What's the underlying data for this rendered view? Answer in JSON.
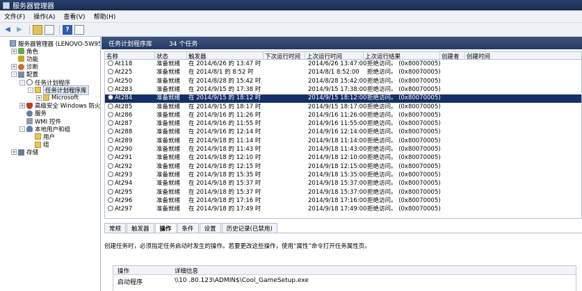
{
  "window": {
    "title": "服务器管理器"
  },
  "menu": [
    "文件(F)",
    "操作(A)",
    "查看(V)",
    "帮助(H)"
  ],
  "toolbar": {
    "icons": [
      "back-arrow-icon",
      "forward-arrow-icon",
      "up-folder-icon",
      "show-hide-tree-icon",
      "help-icon",
      "properties-icon"
    ]
  },
  "tree": [
    {
      "label": "服务器管理器 (LENOVO-5W9563FA",
      "indent": 0,
      "icon": "srv",
      "expander": ""
    },
    {
      "label": "角色",
      "indent": 1,
      "icon": "role",
      "expander": "+"
    },
    {
      "label": "功能",
      "indent": 1,
      "icon": "feat",
      "expander": ""
    },
    {
      "label": "诊断",
      "indent": 1,
      "icon": "diag",
      "expander": "+"
    },
    {
      "label": "配置",
      "indent": 1,
      "icon": "conf",
      "expander": "-"
    },
    {
      "label": "任务计划程序",
      "indent": 2,
      "icon": "clock",
      "expander": "-"
    },
    {
      "label": "任务计划程序库",
      "indent": 3,
      "icon": "fold",
      "expander": "-",
      "selected": true
    },
    {
      "label": "Microsoft",
      "indent": 4,
      "icon": "fold",
      "expander": "+"
    },
    {
      "label": "高级安全 Windows 防火墙",
      "indent": 2,
      "icon": "shield",
      "expander": "+"
    },
    {
      "label": "服务",
      "indent": 2,
      "icon": "svc",
      "expander": ""
    },
    {
      "label": "WMI 控件",
      "indent": 2,
      "icon": "wmi",
      "expander": ""
    },
    {
      "label": "本地用户和组",
      "indent": 2,
      "icon": "users",
      "expander": "-"
    },
    {
      "label": "用户",
      "indent": 3,
      "icon": "fold",
      "expander": ""
    },
    {
      "label": "组",
      "indent": 3,
      "icon": "fold",
      "expander": ""
    },
    {
      "label": "存储",
      "indent": 1,
      "icon": "store",
      "expander": "+"
    }
  ],
  "main": {
    "title": "任务计划程序库",
    "count": "34 个任务"
  },
  "columns": [
    "名称",
    "状态",
    "触发器",
    "下次运行时间",
    "上次运行时间",
    "上次运行结果",
    "创建者",
    "创建时间"
  ],
  "rows": [
    {
      "name": "At118",
      "status": "准备就绪",
      "trigger": "在 2014/6/26 的 13:47 时",
      "next": "",
      "last": "2014/6/26 13:47:00",
      "result": "拒绝访问。 (0x80070005)"
    },
    {
      "name": "At225",
      "status": "准备就绪",
      "trigger": "在 2014/8/1 的 8:52 时",
      "next": "",
      "last": "2014/8/1 8:52:00",
      "result": "拒绝访问。 (0x80070005)"
    },
    {
      "name": "At250",
      "status": "准备就绪",
      "trigger": "在 2014/8/28 的 15:42 时",
      "next": "",
      "last": "2014/8/28 15:42:00",
      "result": "拒绝访问。 (0x80070005)"
    },
    {
      "name": "At283",
      "status": "准备就绪",
      "trigger": "在 2014/9/15 的 17:38 时",
      "next": "",
      "last": "2014/9/15 17:38:00",
      "result": "拒绝访问。 (0x80070005)"
    },
    {
      "name": "At284",
      "status": "准备就绪",
      "trigger": "在 2014/9/15 的 18:12 时",
      "next": "",
      "last": "2014/9/15 18:12:00",
      "result": "拒绝访问。 (0x80070005)",
      "selected": true
    },
    {
      "name": "At285",
      "status": "准备就绪",
      "trigger": "在 2014/9/15 的 18:17 时",
      "next": "",
      "last": "2014/9/15 18:17:00",
      "result": "拒绝访问。 (0x80070005)"
    },
    {
      "name": "At286",
      "status": "准备就绪",
      "trigger": "在 2014/9/16 的 11:26 时",
      "next": "",
      "last": "2014/9/16 11:26:00",
      "result": "拒绝访问。 (0x80070005)"
    },
    {
      "name": "At287",
      "status": "准备就绪",
      "trigger": "在 2014/9/16 的 11:55 时",
      "next": "",
      "last": "2014/9/16 11:55:00",
      "result": "拒绝访问。 (0x80070005)"
    },
    {
      "name": "At288",
      "status": "准备就绪",
      "trigger": "在 2014/9/16 的 12:14 时",
      "next": "",
      "last": "2014/9/16 12:14:00",
      "result": "拒绝访问。 (0x80070005)"
    },
    {
      "name": "At289",
      "status": "准备就绪",
      "trigger": "在 2014/9/18 的 11:14 时",
      "next": "",
      "last": "2014/9/18 11:14:00",
      "result": "拒绝访问。 (0x80070005)"
    },
    {
      "name": "At290",
      "status": "准备就绪",
      "trigger": "在 2014/9/18 的 11:43 时",
      "next": "",
      "last": "2014/9/18 11:43:00",
      "result": "拒绝访问。 (0x80070005)"
    },
    {
      "name": "At291",
      "status": "准备就绪",
      "trigger": "在 2014/9/18 的 12:10 时",
      "next": "",
      "last": "2014/9/18 12:10:00",
      "result": "拒绝访问。 (0x80070005)"
    },
    {
      "name": "At292",
      "status": "准备就绪",
      "trigger": "在 2014/9/18 的 12:15 时",
      "next": "",
      "last": "2014/9/18 12:15:00",
      "result": "拒绝访问。 (0x80070005)"
    },
    {
      "name": "At293",
      "status": "准备就绪",
      "trigger": "在 2014/9/18 的 15:35 时",
      "next": "",
      "last": "2014/9/18 15:35:00",
      "result": "拒绝访问。 (0x80070005)"
    },
    {
      "name": "At294",
      "status": "准备就绪",
      "trigger": "在 2014/9/18 的 15:37 时",
      "next": "",
      "last": "2014/9/18 15:37:00",
      "result": "拒绝访问。 (0x80070005)"
    },
    {
      "name": "At295",
      "status": "准备就绪",
      "trigger": "在 2014/9/18 的 15:37 时",
      "next": "",
      "last": "2014/9/18 15:37:00",
      "result": "拒绝访问。 (0x80070005)"
    },
    {
      "name": "At296",
      "status": "准备就绪",
      "trigger": "在 2014/9/18 的 17:16 时",
      "next": "",
      "last": "2014/9/18 17:16:00",
      "result": "拒绝访问。 (0x80070005)"
    },
    {
      "name": "At297",
      "status": "准备就绪",
      "trigger": "在 2014/9/18 的 17:49 时",
      "next": "",
      "last": "2014/9/18 17:49:00",
      "result": "拒绝访问。 (0x80070005)"
    }
  ],
  "tabs": [
    {
      "label": "常规",
      "active": false
    },
    {
      "label": "触发器",
      "active": false
    },
    {
      "label": "操作",
      "active": true
    },
    {
      "label": "条件",
      "active": false
    },
    {
      "label": "设置",
      "active": false
    },
    {
      "label": "历史记录(已禁用)",
      "active": false
    }
  ],
  "detail": {
    "description": "创建任务时，必须指定任务启动时发生的操作。若要更改这些操作，使用“属性”命令打开任务属性页。",
    "headers": [
      "操作",
      "详细信息"
    ],
    "action": "启动程序",
    "details": "\\\\10    .80.123\\ADMIN$\\Cool_GameSetup.exe"
  }
}
